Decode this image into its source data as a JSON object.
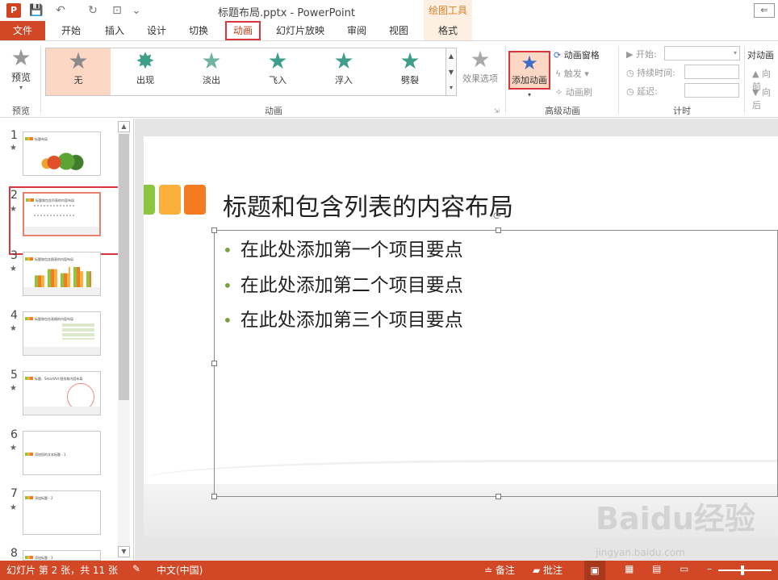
{
  "titlebar": {
    "doc_title": "标题布局.pptx - PowerPoint",
    "drawing_tools": "绘图工具",
    "logo_letter": "P"
  },
  "tabs": {
    "file": "文件",
    "home": "开始",
    "insert": "插入",
    "design": "设计",
    "transitions": "切换",
    "animations": "动画",
    "slideshow": "幻灯片放映",
    "review": "审阅",
    "view": "视图",
    "format": "格式"
  },
  "ribbon": {
    "preview_label": "预览",
    "preview_group": "预览",
    "animation_group": "动画",
    "gallery": [
      {
        "label": "无",
        "color": "#8a8a8a"
      },
      {
        "label": "出现",
        "color": "#3e9e8a"
      },
      {
        "label": "淡出",
        "color": "#6fb3a2"
      },
      {
        "label": "飞入",
        "color": "#3e9e8a"
      },
      {
        "label": "浮入",
        "color": "#3e9e8a"
      },
      {
        "label": "劈裂",
        "color": "#3e9e8a"
      }
    ],
    "effect_options": "效果选项",
    "add_animation": "添加动画",
    "advanced_group": "高级动画",
    "anim_pane": "动画窗格",
    "trigger": "触发",
    "anim_painter": "动画刷",
    "timing_group": "计时",
    "start_label": "开始:",
    "duration_label": "持续时间:",
    "delay_label": "延迟:",
    "reorder_label": "对动画",
    "move_earlier": "向前",
    "move_later": "向后"
  },
  "thumbnails": [
    {
      "num": "1",
      "title": "标题布局"
    },
    {
      "num": "2",
      "title": "标题和包含列表的内容布局"
    },
    {
      "num": "3",
      "title": "标题和包含图表的内容布局"
    },
    {
      "num": "4",
      "title": "标题和包含表格的内容布局"
    },
    {
      "num": "5",
      "title": "标题、SmartArt 图形和内容布局"
    },
    {
      "num": "6",
      "title": "添加您的文本标题 - 1"
    },
    {
      "num": "7",
      "title": "添加标题 - 2"
    },
    {
      "num": "8",
      "title": "添加标题 - 3"
    }
  ],
  "slide": {
    "title": "标题和包含列表的内容布局",
    "bullets": [
      "在此处添加第一个项目要点",
      "在此处添加第二个项目要点",
      "在此处添加第三个项目要点"
    ],
    "deco_colors": [
      "#8cc63e",
      "#fbb03b",
      "#f47b20"
    ]
  },
  "watermark": {
    "brand": "Baidu经验",
    "url": "jingyan.baidu.com"
  },
  "status": {
    "slide_info": "幻灯片 第 2 张，共 11 张",
    "language": "中文(中国)",
    "notes": "备注",
    "comments": "批注"
  }
}
